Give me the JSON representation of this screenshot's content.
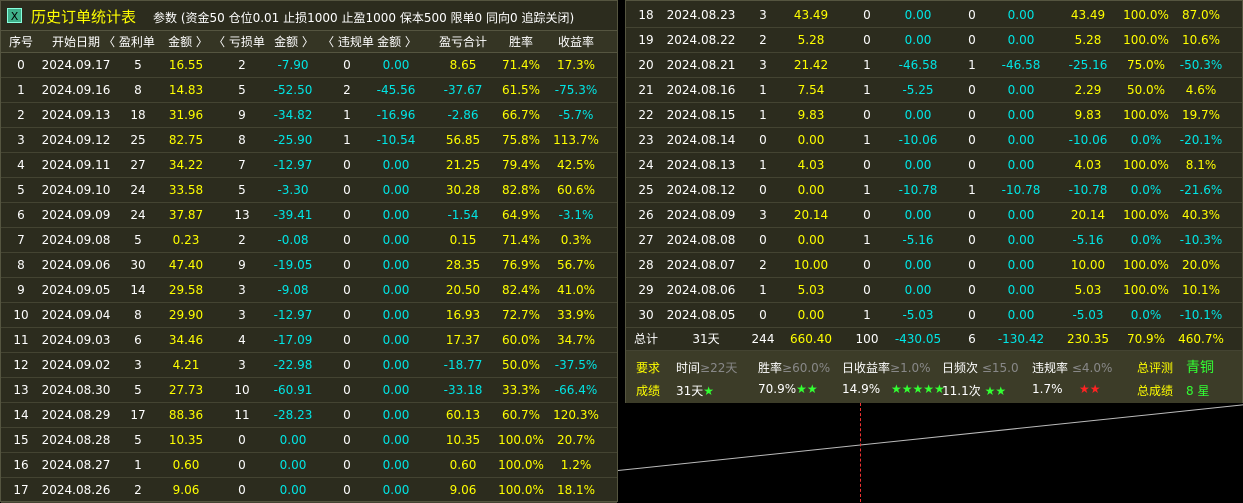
{
  "title": "历史订单统计表",
  "params": "参数 (资金50 仓位0.01 止损1000 止盈1000 保本500   限单0 同向0 追踪关闭)",
  "headers": [
    "序号",
    "开始日期",
    "〈 盈利单",
    "金额 〉",
    "〈 亏损单",
    "金额 〉",
    "〈 违规单",
    "金额 〉",
    "盈亏合计",
    "胜率",
    "收益率"
  ],
  "rows": [
    [
      "0",
      "2024.09.17",
      "5",
      "16.55",
      "2",
      "-7.90",
      "0",
      "0.00",
      "8.65",
      "71.4%",
      "17.3%"
    ],
    [
      "1",
      "2024.09.16",
      "8",
      "14.83",
      "5",
      "-52.50",
      "2",
      "-45.56",
      "-37.67",
      "61.5%",
      "-75.3%"
    ],
    [
      "2",
      "2024.09.13",
      "18",
      "31.96",
      "9",
      "-34.82",
      "1",
      "-16.96",
      "-2.86",
      "66.7%",
      "-5.7%"
    ],
    [
      "3",
      "2024.09.12",
      "25",
      "82.75",
      "8",
      "-25.90",
      "1",
      "-10.54",
      "56.85",
      "75.8%",
      "113.7%"
    ],
    [
      "4",
      "2024.09.11",
      "27",
      "34.22",
      "7",
      "-12.97",
      "0",
      "0.00",
      "21.25",
      "79.4%",
      "42.5%"
    ],
    [
      "5",
      "2024.09.10",
      "24",
      "33.58",
      "5",
      "-3.30",
      "0",
      "0.00",
      "30.28",
      "82.8%",
      "60.6%"
    ],
    [
      "6",
      "2024.09.09",
      "24",
      "37.87",
      "13",
      "-39.41",
      "0",
      "0.00",
      "-1.54",
      "64.9%",
      "-3.1%"
    ],
    [
      "7",
      "2024.09.08",
      "5",
      "0.23",
      "2",
      "-0.08",
      "0",
      "0.00",
      "0.15",
      "71.4%",
      "0.3%"
    ],
    [
      "8",
      "2024.09.06",
      "30",
      "47.40",
      "9",
      "-19.05",
      "0",
      "0.00",
      "28.35",
      "76.9%",
      "56.7%"
    ],
    [
      "9",
      "2024.09.05",
      "14",
      "29.58",
      "3",
      "-9.08",
      "0",
      "0.00",
      "20.50",
      "82.4%",
      "41.0%"
    ],
    [
      "10",
      "2024.09.04",
      "8",
      "29.90",
      "3",
      "-12.97",
      "0",
      "0.00",
      "16.93",
      "72.7%",
      "33.9%"
    ],
    [
      "11",
      "2024.09.03",
      "6",
      "34.46",
      "4",
      "-17.09",
      "0",
      "0.00",
      "17.37",
      "60.0%",
      "34.7%"
    ],
    [
      "12",
      "2024.09.02",
      "3",
      "4.21",
      "3",
      "-22.98",
      "0",
      "0.00",
      "-18.77",
      "50.0%",
      "-37.5%"
    ],
    [
      "13",
      "2024.08.30",
      "5",
      "27.73",
      "10",
      "-60.91",
      "0",
      "0.00",
      "-33.18",
      "33.3%",
      "-66.4%"
    ],
    [
      "14",
      "2024.08.29",
      "17",
      "88.36",
      "11",
      "-28.23",
      "0",
      "0.00",
      "60.13",
      "60.7%",
      "120.3%"
    ],
    [
      "15",
      "2024.08.28",
      "5",
      "10.35",
      "0",
      "0.00",
      "0",
      "0.00",
      "10.35",
      "100.0%",
      "20.7%"
    ],
    [
      "16",
      "2024.08.27",
      "1",
      "0.60",
      "0",
      "0.00",
      "0",
      "0.00",
      "0.60",
      "100.0%",
      "1.2%"
    ],
    [
      "17",
      "2024.08.26",
      "2",
      "9.06",
      "0",
      "0.00",
      "0",
      "0.00",
      "9.06",
      "100.0%",
      "18.1%"
    ],
    [
      "18",
      "2024.08.23",
      "3",
      "43.49",
      "0",
      "0.00",
      "0",
      "0.00",
      "43.49",
      "100.0%",
      "87.0%"
    ],
    [
      "19",
      "2024.08.22",
      "2",
      "5.28",
      "0",
      "0.00",
      "0",
      "0.00",
      "5.28",
      "100.0%",
      "10.6%"
    ],
    [
      "20",
      "2024.08.21",
      "3",
      "21.42",
      "1",
      "-46.58",
      "1",
      "-46.58",
      "-25.16",
      "75.0%",
      "-50.3%"
    ],
    [
      "21",
      "2024.08.16",
      "1",
      "7.54",
      "1",
      "-5.25",
      "0",
      "0.00",
      "2.29",
      "50.0%",
      "4.6%"
    ],
    [
      "22",
      "2024.08.15",
      "1",
      "9.83",
      "0",
      "0.00",
      "0",
      "0.00",
      "9.83",
      "100.0%",
      "19.7%"
    ],
    [
      "23",
      "2024.08.14",
      "0",
      "0.00",
      "1",
      "-10.06",
      "0",
      "0.00",
      "-10.06",
      "0.0%",
      "-20.1%"
    ],
    [
      "24",
      "2024.08.13",
      "1",
      "4.03",
      "0",
      "0.00",
      "0",
      "0.00",
      "4.03",
      "100.0%",
      "8.1%"
    ],
    [
      "25",
      "2024.08.12",
      "0",
      "0.00",
      "1",
      "-10.78",
      "1",
      "-10.78",
      "-10.78",
      "0.0%",
      "-21.6%"
    ],
    [
      "26",
      "2024.08.09",
      "3",
      "20.14",
      "0",
      "0.00",
      "0",
      "0.00",
      "20.14",
      "100.0%",
      "40.3%"
    ],
    [
      "27",
      "2024.08.08",
      "0",
      "0.00",
      "1",
      "-5.16",
      "0",
      "0.00",
      "-5.16",
      "0.0%",
      "-10.3%"
    ],
    [
      "28",
      "2024.08.07",
      "2",
      "10.00",
      "0",
      "0.00",
      "0",
      "0.00",
      "10.00",
      "100.0%",
      "20.0%"
    ],
    [
      "29",
      "2024.08.06",
      "1",
      "5.03",
      "0",
      "0.00",
      "0",
      "0.00",
      "5.03",
      "100.0%",
      "10.1%"
    ],
    [
      "30",
      "2024.08.05",
      "0",
      "0.00",
      "1",
      "-5.03",
      "0",
      "0.00",
      "-5.03",
      "0.0%",
      "-10.1%"
    ]
  ],
  "total": [
    "总计",
    "31天",
    "244",
    "660.40",
    "100",
    "-430.05",
    "6",
    "-130.42",
    "230.35",
    "70.9%",
    "460.7%"
  ],
  "summary": {
    "req_label": "要求",
    "res_label": "成绩",
    "time_label": "时间",
    "time_req": "≥22天",
    "time_res": "31天",
    "time_stars": "★",
    "win_label": "胜率",
    "win_req": "≥60.0%",
    "win_res": "70.9%",
    "win_stars": "★★",
    "daily_label": "日收益率",
    "daily_req": "≥1.0%",
    "daily_res": "14.9%",
    "daily_stars": "★★★★★",
    "freq_label": "日频次",
    "freq_req": "≤15.0",
    "freq_res": "11.1次",
    "freq_stars": "★★",
    "vio_label": "违规率",
    "vio_req": "≤4.0%",
    "vio_res": "1.7%",
    "vio_stars": "★★",
    "eval_label": "总评测",
    "eval_value": "青铜",
    "score_label": "总成绩",
    "score_value": "8 星"
  },
  "colors": {
    "positive": "#ffff00",
    "negative": "#00e5e5",
    "star_good": "#33ff33",
    "star_bad": "#ff2222"
  }
}
